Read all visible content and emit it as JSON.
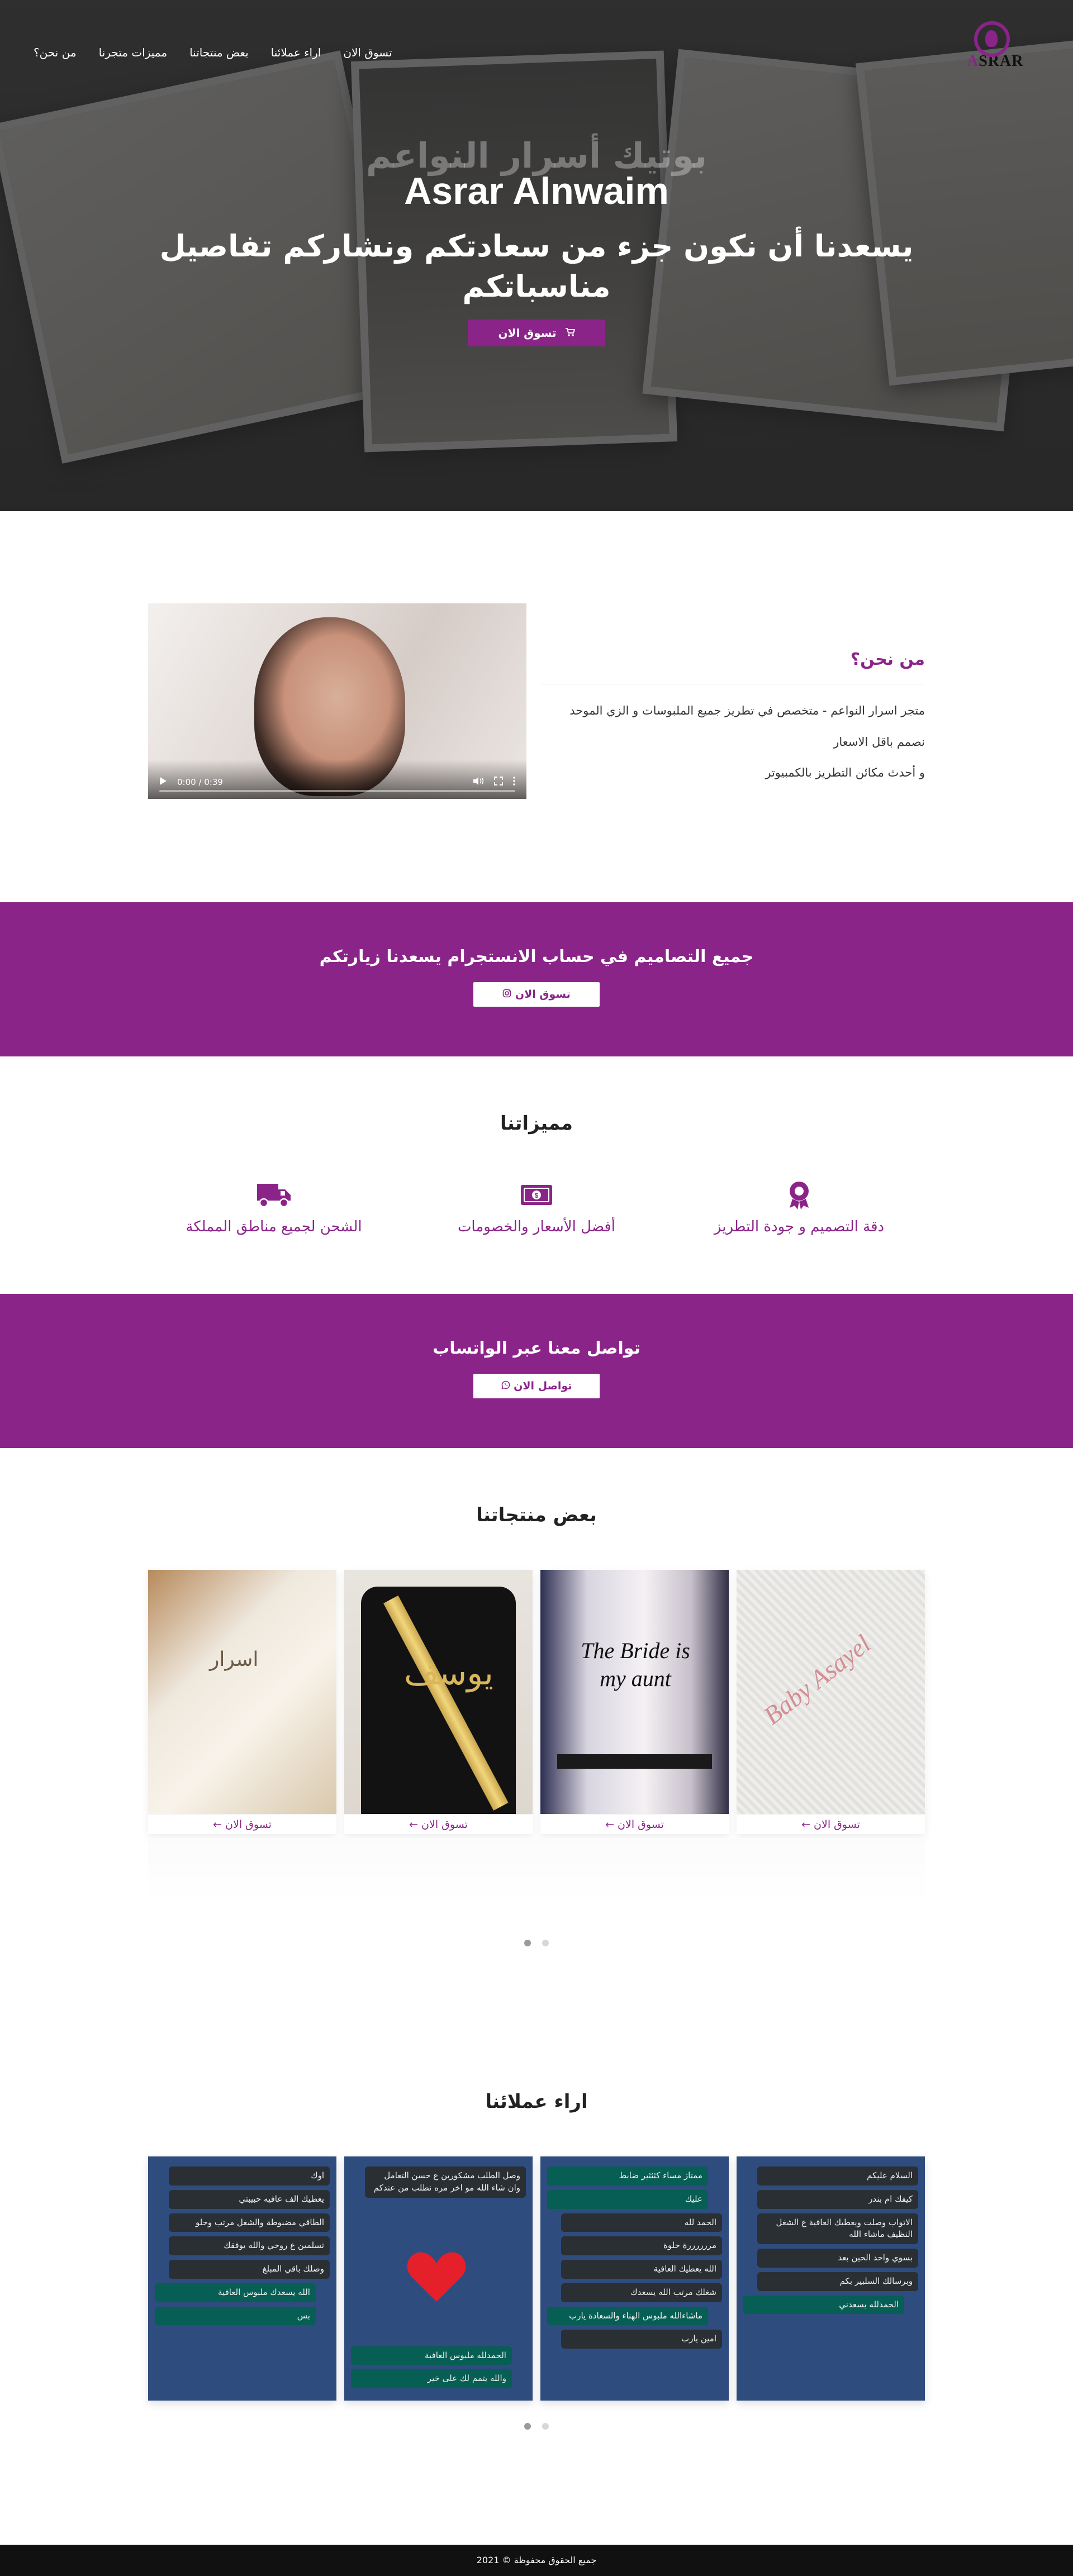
{
  "nav": {
    "items": [
      "من نحن؟",
      "مميزات متجرنا",
      "بعض منتجاتنا",
      "اراء عملائنا",
      "تسوق الان"
    ],
    "logo_text": "SRAR",
    "logo_letter": "A"
  },
  "hero": {
    "arabic_title": "بوتيك أسرار النواعم",
    "title": "Asrar Alnwaim",
    "tagline": "يسعدنا أن نكون جزء من سعادتكم ونشاركم تفاصيل مناسباتكم",
    "button_label": "تسوق الان",
    "button_icon": "cart-icon"
  },
  "about": {
    "heading": "من نحن؟",
    "paragraphs": [
      "متجر اسرار النواعم - متخصص في تطريز جميع الملبوسات و الزي الموحد",
      "نصمم باقل الاسعار",
      "و أحدث مكائن التطريز بالكمبيوتر"
    ],
    "video_time": "0:00 / 0:39"
  },
  "instagram_band": {
    "text": "جميع التصاميم في حساب الانستجرام يسعدنا زيارتكم",
    "button_label": "تسوق الان",
    "button_icon": "instagram-icon"
  },
  "features": {
    "title": "مميزاتنا",
    "items": [
      {
        "label": "دقة التصميم و جودة التطريز",
        "icon": "award-icon"
      },
      {
        "label": "أفضل الأسعار والخصومات",
        "icon": "money-icon"
      },
      {
        "label": "الشحن لجميع مناطق المملكة",
        "icon": "truck-icon"
      }
    ]
  },
  "whatsapp_band": {
    "text": "تواصل معنا عبر الواتساب",
    "button_label": "تواصل الان",
    "button_icon": "whatsapp-icon"
  },
  "products": {
    "title": "بعض منتجاتنا",
    "items": [
      {
        "cta": "تسوق الان",
        "image_text": "اسرار"
      },
      {
        "cta": "تسوق الان",
        "image_text": "يوسف"
      },
      {
        "cta": "تسوق الان",
        "image_text": "The Bride is my aunt"
      },
      {
        "cta": "تسوق الان",
        "image_text": "Baby Asayel"
      }
    ]
  },
  "reviews": {
    "title": "اراء عملائنا",
    "cards": [
      {
        "messages": [
          {
            "dir": "in",
            "text": "اوك"
          },
          {
            "dir": "in",
            "text": "يعطيك الف عافيه حبيبتي"
          },
          {
            "dir": "in",
            "text": "الطاقي مضبوطة والشغل مرتب وحلو"
          },
          {
            "dir": "in",
            "text": "تسلمين ع روحي والله يوفقك"
          },
          {
            "dir": "in",
            "text": "وصلك باقي المبلغ"
          },
          {
            "dir": "out",
            "text": "الله يسعدك ملبوس العافية"
          },
          {
            "dir": "out",
            "text": "بس"
          }
        ]
      },
      {
        "messages": [
          {
            "dir": "in",
            "text": "وصل الطلب مشكورين ع حسن التعامل وان شاء الله مو اخر مره نطلب من عندكم"
          },
          {
            "dir": "out",
            "text": "الحمدلله ملبوس العافية"
          },
          {
            "dir": "out",
            "text": "والله يتمم لك على خير"
          }
        ]
      },
      {
        "messages": [
          {
            "dir": "out",
            "text": "ممتاز مساء كثثثير ضابط"
          },
          {
            "dir": "out",
            "text": "عليك"
          },
          {
            "dir": "in",
            "text": "الحمد لله"
          },
          {
            "dir": "in",
            "text": "مررررررة حلوة"
          },
          {
            "dir": "in",
            "text": "الله يعطيك العافية"
          },
          {
            "dir": "in",
            "text": "شغلك مرتب الله يسعدك"
          },
          {
            "dir": "out",
            "text": "ماشاءالله ملبوس الهناء والسعادة يارب"
          },
          {
            "dir": "in",
            "text": "امين يارب"
          }
        ]
      },
      {
        "messages": [
          {
            "dir": "in",
            "text": "السلام عليكم"
          },
          {
            "dir": "in",
            "text": "كيفك ام بندر"
          },
          {
            "dir": "in",
            "text": "الاتواب وصلت ويعطيك العافية ع الشغل النظيف ماشاء الله"
          },
          {
            "dir": "in",
            "text": "بسوي واحد الحين بعد"
          },
          {
            "dir": "in",
            "text": "وبرسالك السلبير بكم"
          },
          {
            "dir": "out",
            "text": "الحمدلله يسعدني"
          }
        ]
      }
    ]
  },
  "footer": {
    "text": "جميع الحقوق محفوظة © 2021"
  },
  "colors": {
    "brand": "#8b2489",
    "footer_bg": "#111111",
    "review_bg": "#2f4c7e"
  }
}
